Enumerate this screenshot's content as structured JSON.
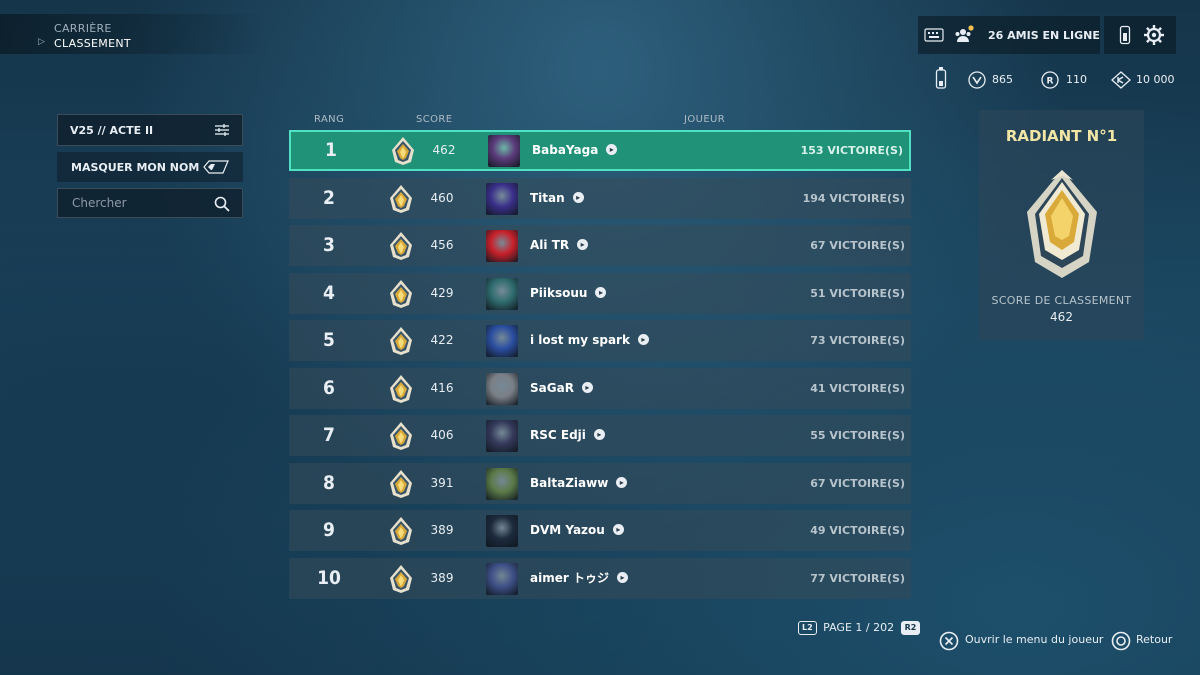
{
  "breadcrumb": {
    "parent": "CARRIÈRE",
    "current": "CLASSEMENT"
  },
  "left_panel": {
    "act_label": "V25 // ACTE II",
    "mask_label": "MASQUER MON NOM",
    "search_placeholder": "Chercher"
  },
  "table": {
    "headers": {
      "rank": "RANG",
      "score": "SCORE",
      "player": "JOUEUR"
    },
    "rows": [
      {
        "rank": "1",
        "score": "462",
        "name": "BabaYaga",
        "wins": "153 VICTOIRE(S)",
        "avatar_color": "#5b3a7a"
      },
      {
        "rank": "2",
        "score": "460",
        "name": "Titan",
        "wins": "194 VICTOIRE(S)",
        "avatar_color": "#3a2f8a"
      },
      {
        "rank": "3",
        "score": "456",
        "name": "Ali TR",
        "wins": "67 VICTOIRE(S)",
        "avatar_color": "#c8202a"
      },
      {
        "rank": "4",
        "score": "429",
        "name": "Piiksouu",
        "wins": "51 VICTOIRE(S)",
        "avatar_color": "#2f6c6f"
      },
      {
        "rank": "5",
        "score": "422",
        "name": "i lost my spark",
        "wins": "73 VICTOIRE(S)",
        "avatar_color": "#2a4ea0"
      },
      {
        "rank": "6",
        "score": "416",
        "name": "SaGaR",
        "wins": "41 VICTOIRE(S)",
        "avatar_color": "#7a7f86"
      },
      {
        "rank": "7",
        "score": "406",
        "name": "RSC Edji",
        "wins": "55 VICTOIRE(S)",
        "avatar_color": "#34395a"
      },
      {
        "rank": "8",
        "score": "391",
        "name": "BaltaZiaww",
        "wins": "67 VICTOIRE(S)",
        "avatar_color": "#5b7a48"
      },
      {
        "rank": "9",
        "score": "389",
        "name": "DVM Yazou",
        "wins": "49 VICTOIRE(S)",
        "avatar_color": "#1c2a3c"
      },
      {
        "rank": "10",
        "score": "389",
        "name": "aimer トゥジ",
        "wins": "77 VICTOIRE(S)",
        "avatar_color": "#3d4f86"
      }
    ]
  },
  "top_bar": {
    "friends_online": "26 AMIS EN LIGNE",
    "currencies": [
      {
        "icon": "valorant-points-icon",
        "value": "865"
      },
      {
        "icon": "radianite-icon",
        "value": "110"
      },
      {
        "icon": "kingdom-credits-icon",
        "value": "10 000"
      }
    ]
  },
  "rank_card": {
    "title": "RADIANT N°1",
    "score_label": "SCORE DE CLASSEMENT",
    "score_value": "462"
  },
  "pager": {
    "left_key": "L2",
    "text": "PAGE 1 / 202",
    "right_key": "R2"
  },
  "hints": {
    "open_menu": "Ouvrir le menu du joueur",
    "back": "Retour"
  },
  "colors": {
    "highlight_row": "#1f9278",
    "highlight_border": "#4fe2c2",
    "radiant_gold": "#f2e6a6"
  }
}
